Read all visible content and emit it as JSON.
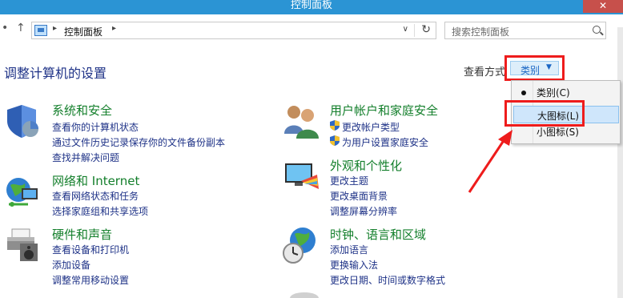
{
  "window": {
    "title": "控制面板",
    "close_glyph": "✕"
  },
  "nav": {
    "back_glyph": "•",
    "up_glyph": "↑"
  },
  "address": {
    "sep1": "▸",
    "breadcrumb": "控制面板",
    "sep2": "▸",
    "dropdown_glyph": "∨",
    "refresh_glyph": "↻"
  },
  "search": {
    "placeholder": "搜索控制面板"
  },
  "header": {
    "title": "调整计算机的设置",
    "view_by_label": "查看方式",
    "view_by_value": "类别",
    "caret": "▼"
  },
  "view_menu": {
    "items": [
      {
        "label": "类别(C)",
        "selected": true
      },
      {
        "label": "大图标(L)",
        "highlighted": true
      },
      {
        "label": "小图标(S)"
      }
    ]
  },
  "categories": [
    {
      "id": "system-security",
      "title": "系统和安全",
      "icon": "shield-icon",
      "links": [
        "查看你的计算机状态",
        "通过文件历史记录保存你的文件备份副本",
        "查找并解决问题"
      ]
    },
    {
      "id": "network-internet",
      "title": "网络和 Internet",
      "icon": "network-globe-icon",
      "links": [
        "查看网络状态和任务",
        "选择家庭组和共享选项"
      ]
    },
    {
      "id": "hardware-sound",
      "title": "硬件和声音",
      "icon": "printer-icon",
      "links": [
        "查看设备和打印机",
        "添加设备",
        "调整常用移动设置"
      ]
    },
    {
      "id": "user-accounts",
      "title": "用户帐户和家庭安全",
      "icon": "users-icon",
      "links": [
        "更改帐户类型",
        "为用户设置家庭安全"
      ]
    },
    {
      "id": "appearance",
      "title": "外观和个性化",
      "icon": "monitor-palette-icon",
      "links": [
        "更改主题",
        "更改桌面背景",
        "调整屏幕分辨率"
      ]
    },
    {
      "id": "clock-region",
      "title": "时钟、语言和区域",
      "icon": "globe-clock-icon",
      "links": [
        "添加语言",
        "更换输入法",
        "更改日期、时间或数字格式"
      ]
    }
  ],
  "colors": {
    "titlebar": "#2b94d4",
    "link": "#1e3287",
    "category_title": "#137f2b",
    "annotation_red": "#ee1c1c",
    "close_button": "#c7504b"
  }
}
